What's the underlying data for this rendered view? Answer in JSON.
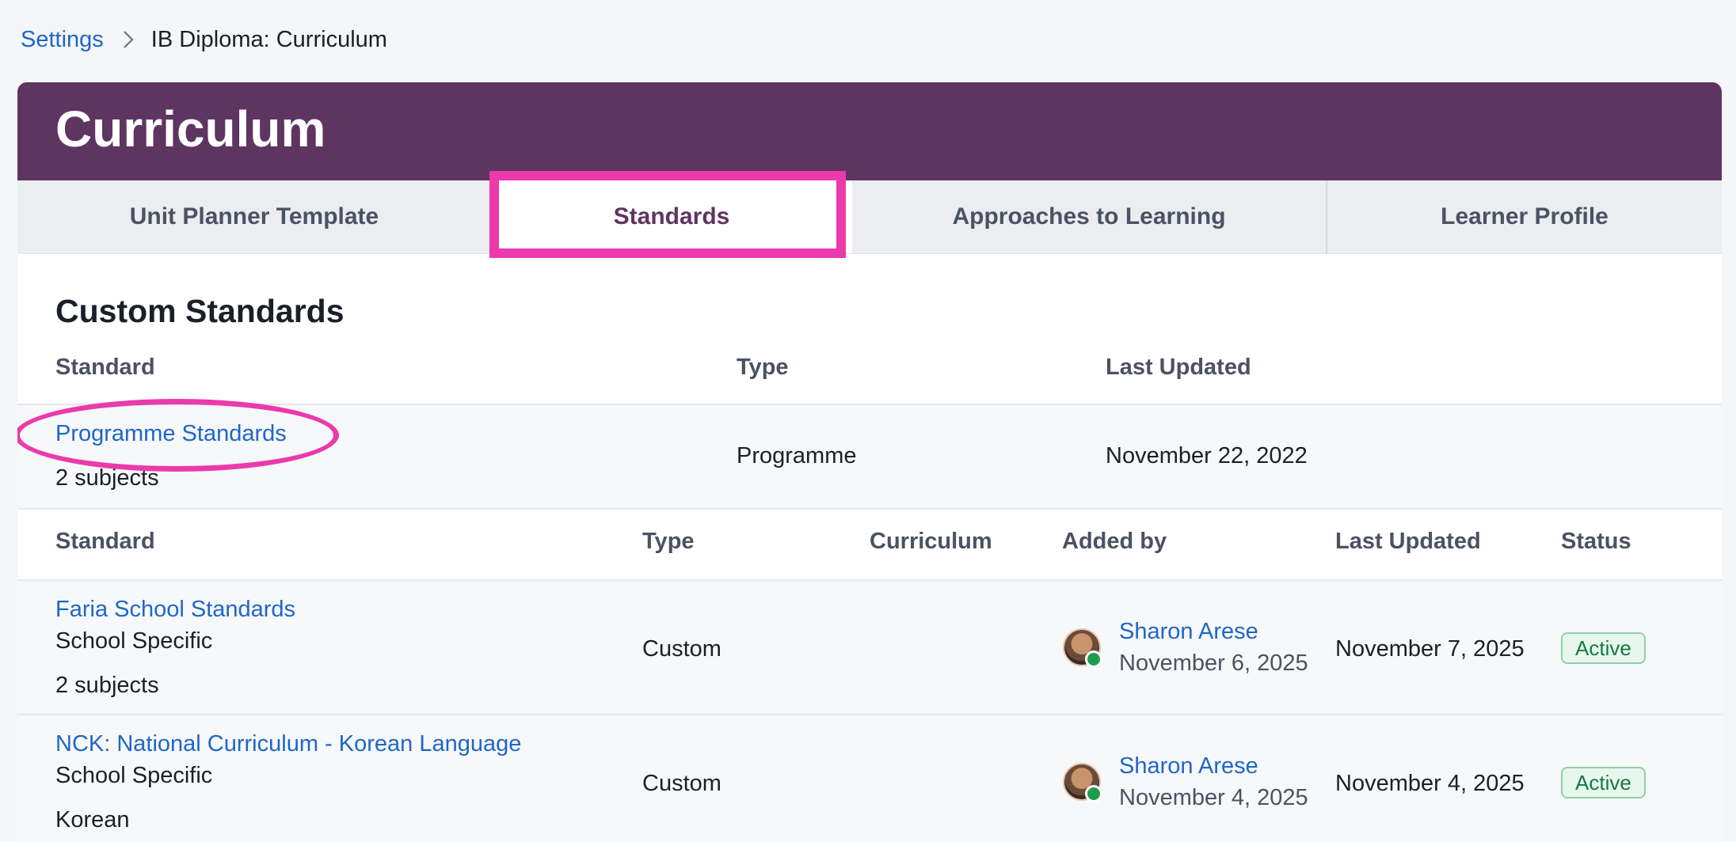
{
  "breadcrumb": {
    "root": "Settings",
    "current": "IB Diploma: Curriculum"
  },
  "header": {
    "title": "Curriculum"
  },
  "tabs": [
    "Unit Planner Template",
    "Standards",
    "Approaches to Learning",
    "Learner Profile"
  ],
  "active_tab": "Standards",
  "section": {
    "title": "Custom Standards"
  },
  "programme_table": {
    "headers": {
      "standard": "Standard",
      "type": "Type",
      "updated": "Last Updated"
    },
    "row": {
      "name": "Programme Standards",
      "subjects": "2 subjects",
      "type": "Programme",
      "updated": "November 22, 2022"
    }
  },
  "standards_table": {
    "headers": {
      "standard": "Standard",
      "type": "Type",
      "curriculum": "Curriculum",
      "added_by": "Added by",
      "updated": "Last Updated",
      "status": "Status"
    },
    "rows": [
      {
        "name": "Faria School Standards",
        "category": "School Specific",
        "extra": "2 subjects",
        "type": "Custom",
        "added_by": "Sharon Arese",
        "added_date": "November 6, 2025",
        "updated": "November 7, 2025",
        "status": "Active"
      },
      {
        "name": "NCK: National Curriculum - Korean Language",
        "category": "School Specific",
        "extra": "Korean",
        "type": "Custom",
        "added_by": "Sharon Arese",
        "added_date": "November 4, 2025",
        "updated": "November 4, 2025",
        "status": "Active"
      }
    ]
  },
  "colors": {
    "header_bg": "#5e3461",
    "link": "#1f66c9",
    "highlight": "#ea3aac",
    "active_badge": "#137a3f"
  },
  "icons": {
    "breadcrumb_separator": "chevron-right-icon",
    "online_status": "online-dot-icon"
  }
}
